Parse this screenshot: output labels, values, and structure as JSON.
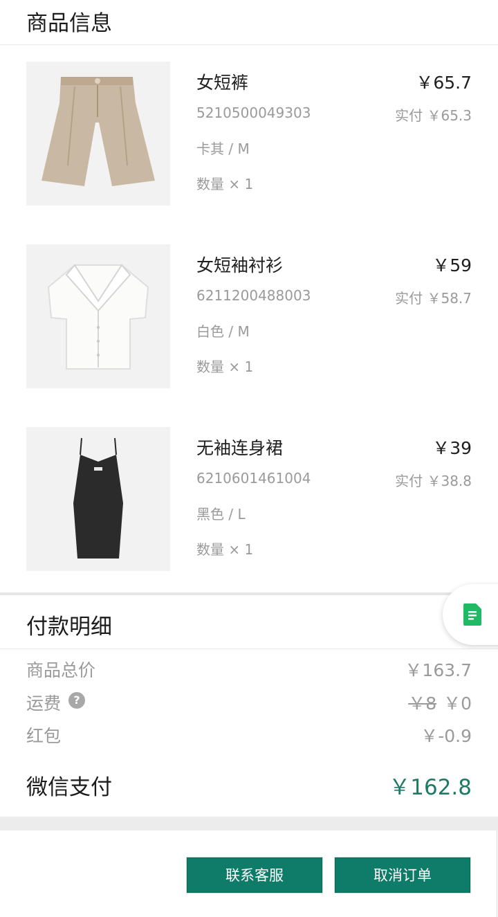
{
  "header": {
    "title": "商品信息"
  },
  "products": [
    {
      "name": "女短裤",
      "price": "￥65.7",
      "sku": "5210500049303",
      "paid": "实付 ￥65.3",
      "spec": "卡其 / M",
      "qty": "数量 × 1",
      "image": "khaki-shorts-image"
    },
    {
      "name": "女短袖衬衫",
      "price": "￥59",
      "sku": "6211200488003",
      "paid": "实付 ￥58.7",
      "spec": "白色 / M",
      "qty": "数量 × 1",
      "image": "white-blouse-image"
    },
    {
      "name": "无袖连身裙",
      "price": "￥39",
      "sku": "6210601461004",
      "paid": "实付 ￥38.8",
      "spec": "黑色 / L",
      "qty": "数量 × 1",
      "image": "black-dress-image"
    }
  ],
  "payment": {
    "title": "付款明细",
    "rows": [
      {
        "label": "商品总价",
        "value": "￥163.7"
      },
      {
        "label": "运费",
        "original": "￥8",
        "value": "￥0",
        "help_icon": "question-icon"
      },
      {
        "label": "红包",
        "value": "￥-0.9"
      }
    ],
    "total_label": "微信支付",
    "total_value": "￥162.8"
  },
  "actions": {
    "contact_service": "联系客服",
    "cancel_order": "取消订单"
  },
  "floating": {
    "icon": "document-icon"
  },
  "colors": {
    "accent": "#0e7c68",
    "total_text": "#1e7a66",
    "muted": "#9a9a9a"
  }
}
